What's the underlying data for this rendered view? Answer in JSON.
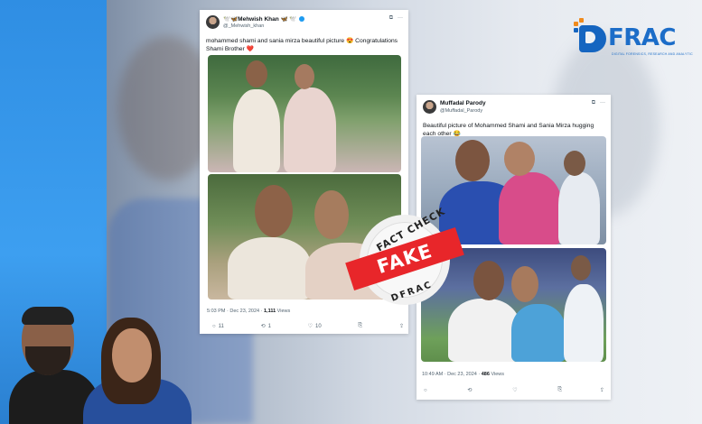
{
  "logo": {
    "text": "FRAC",
    "tagline": "DIGITAL FORENSICS, RESEARCH AND ANALYTICS CENTER",
    "color": "#1c6dc8",
    "accent": "#f08a1c"
  },
  "tweet1": {
    "name": "🕊️🦋Mehwish Khan 🦋 🕊️",
    "handle": "@_Mehwish_khan",
    "text_main": "mohammed shami and sania mirza beautiful picture 😍 Congratulations Shami Brother",
    "heart": "❤️",
    "timestamp": "5:03 PM · Dec 23, 2024 · ",
    "views_count": "1,111",
    "views_label": " Views",
    "actions": {
      "reply": "11",
      "retweet": "1",
      "like": "10"
    }
  },
  "tweet2": {
    "name": "Muffadal Parody",
    "handle": "@Muffadal_Parody",
    "text_main": "Beautiful picture of Mohammed Shami and Sania Mirza hugging each other 😂",
    "timestamp": "10:49 AM · Dec 23, 2024 · ",
    "views_count": "486",
    "views_label": " Views",
    "actions": {
      "reply": "",
      "retweet": "",
      "like": ""
    }
  },
  "stamp": {
    "top": "FACT CHECK",
    "label": "FAKE",
    "bottom": "DFRAC",
    "color": "#e8262a"
  },
  "icons": {
    "reply": "💬",
    "retweet": "⟲",
    "like": "♡",
    "bookmark": "⎘",
    "share": "⇪"
  }
}
